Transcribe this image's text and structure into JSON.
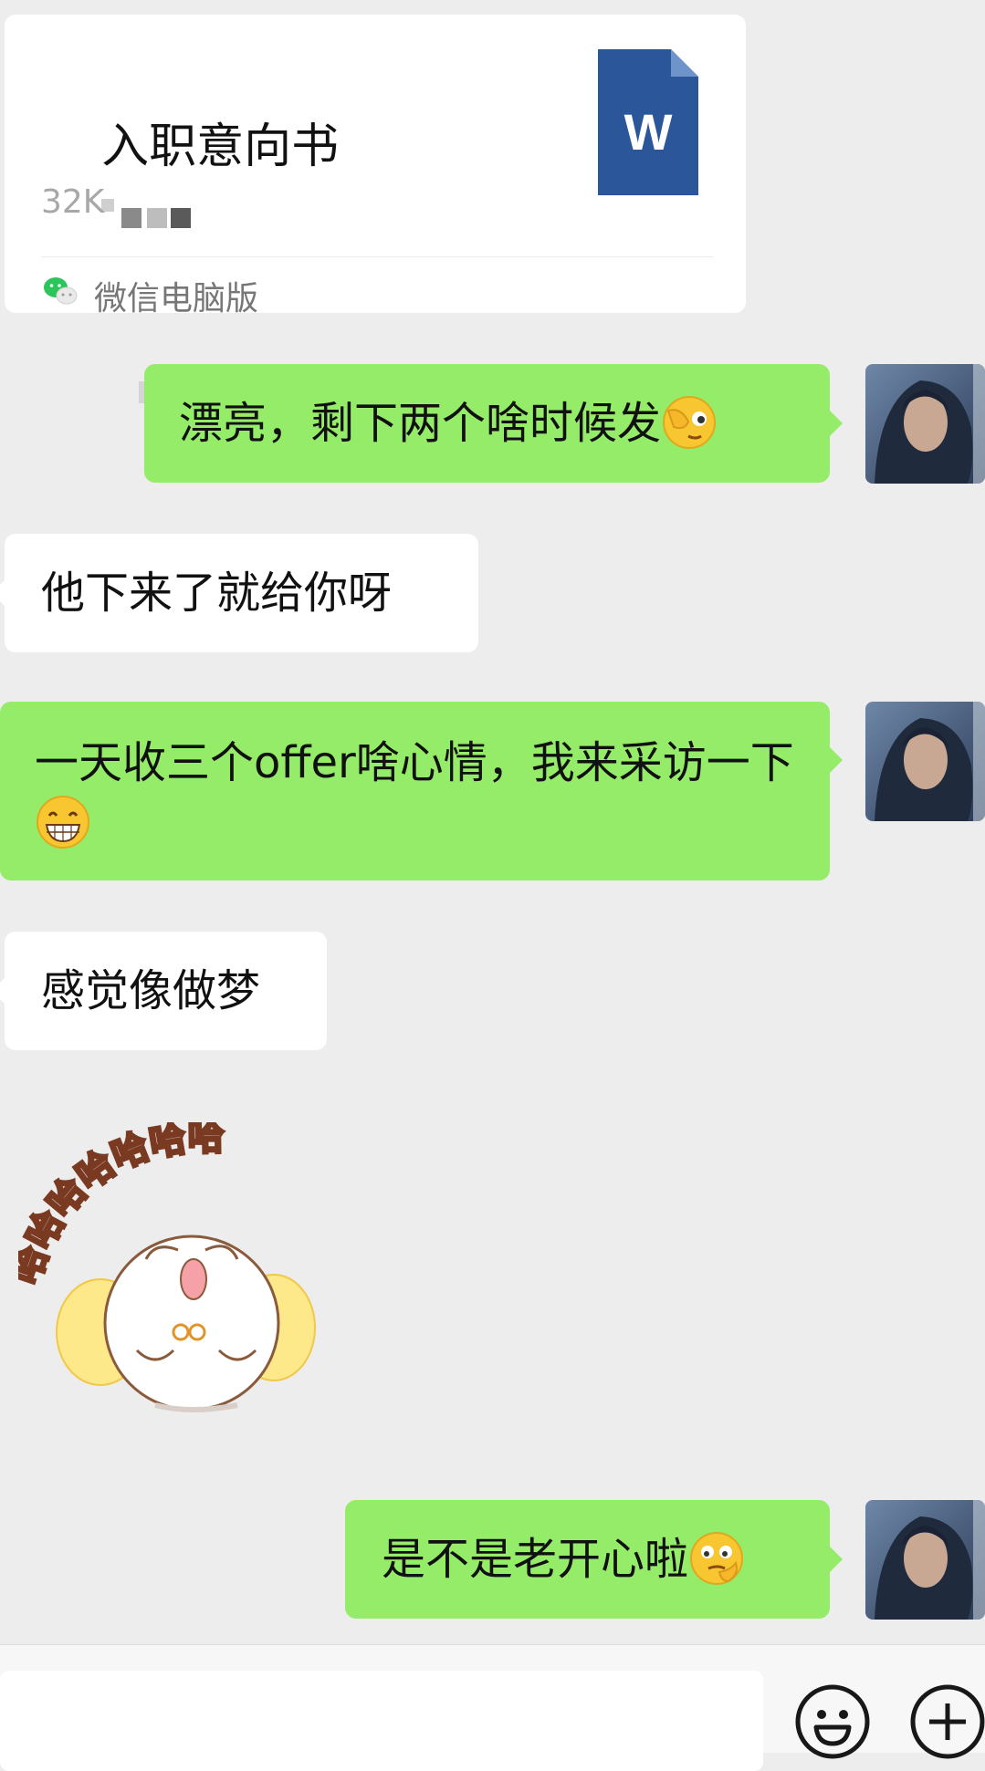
{
  "file_message": {
    "file_name": "入职意向书",
    "file_size": "32K",
    "source": "微信电脑版",
    "file_type": "W",
    "file_type_color": "#2b579a"
  },
  "messages": [
    {
      "side": "out",
      "text": "漂亮，剩下两个啥时候发",
      "emoji": "facepalm-peek-emoji"
    },
    {
      "side": "in",
      "text": "他下来了就给你呀"
    },
    {
      "side": "out",
      "text": "一天收三个offer啥心情，我来采访一下",
      "emoji": "grin-emoji"
    },
    {
      "side": "in",
      "text": "感觉像做梦"
    },
    {
      "side": "in",
      "sticker": "laughing-hamster-sticker",
      "sticker_text": "哈哈哈哈哈哈哈"
    },
    {
      "side": "out",
      "text": "是不是老开心啦",
      "emoji": "smirk-chin-emoji"
    }
  ],
  "input_bar": {
    "placeholder": "",
    "emoji_button_icon": "smiley-icon",
    "more_button_icon": "plus-circle-icon"
  },
  "colors": {
    "background": "#ededed",
    "outgoing_bubble": "#95ec69",
    "incoming_bubble": "#ffffff",
    "wechat_green": "#07c160"
  }
}
